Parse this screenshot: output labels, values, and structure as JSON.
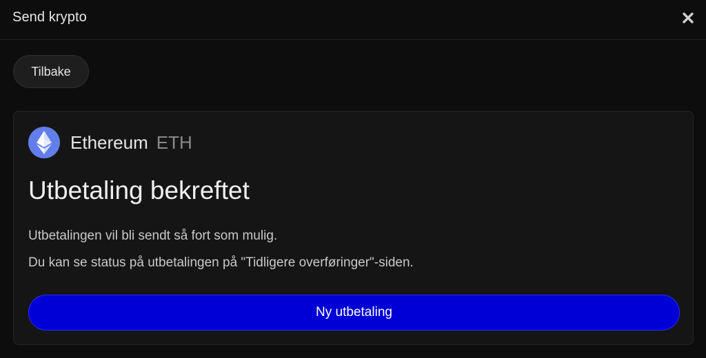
{
  "header": {
    "title": "Send krypto",
    "close_icon": "close-icon"
  },
  "nav": {
    "back_label": "Tilbake"
  },
  "card": {
    "coin": {
      "icon": "ethereum-icon",
      "icon_color": "#627eea",
      "name": "Ethereum",
      "symbol": "ETH"
    },
    "heading": "Utbetaling bekreftet",
    "message_line1": "Utbetalingen vil bli sendt så fort som mulig.",
    "message_line2": "Du kan se status på utbetalingen på \"Tidligere overføringer\"-siden.",
    "button_label": "Ny utbetaling",
    "button_color": "#0000d6"
  }
}
